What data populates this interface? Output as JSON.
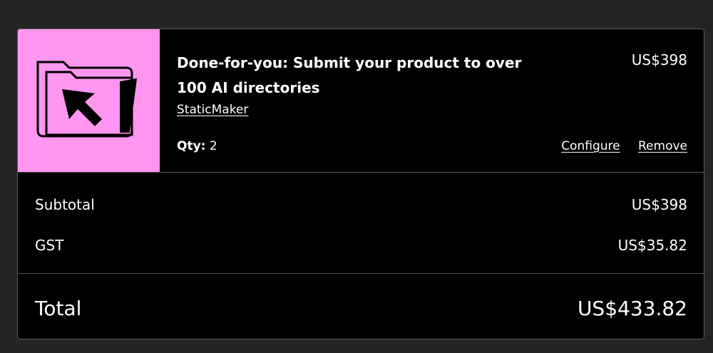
{
  "item": {
    "title": "Done-for-you: Submit your product to over 100 AI directories",
    "price": "US$398",
    "seller": "StaticMaker",
    "qty_label": "Qty:",
    "qty_value": "2",
    "configure_label": "Configure",
    "remove_label": "Remove",
    "thumbnail_icon": "folder-cursor-icon",
    "thumbnail_color": "#ff97f0"
  },
  "summary": {
    "subtotal_label": "Subtotal",
    "subtotal_value": "US$398",
    "tax_label": "GST",
    "tax_value": "US$35.82",
    "total_label": "Total",
    "total_value": "US$433.82"
  }
}
